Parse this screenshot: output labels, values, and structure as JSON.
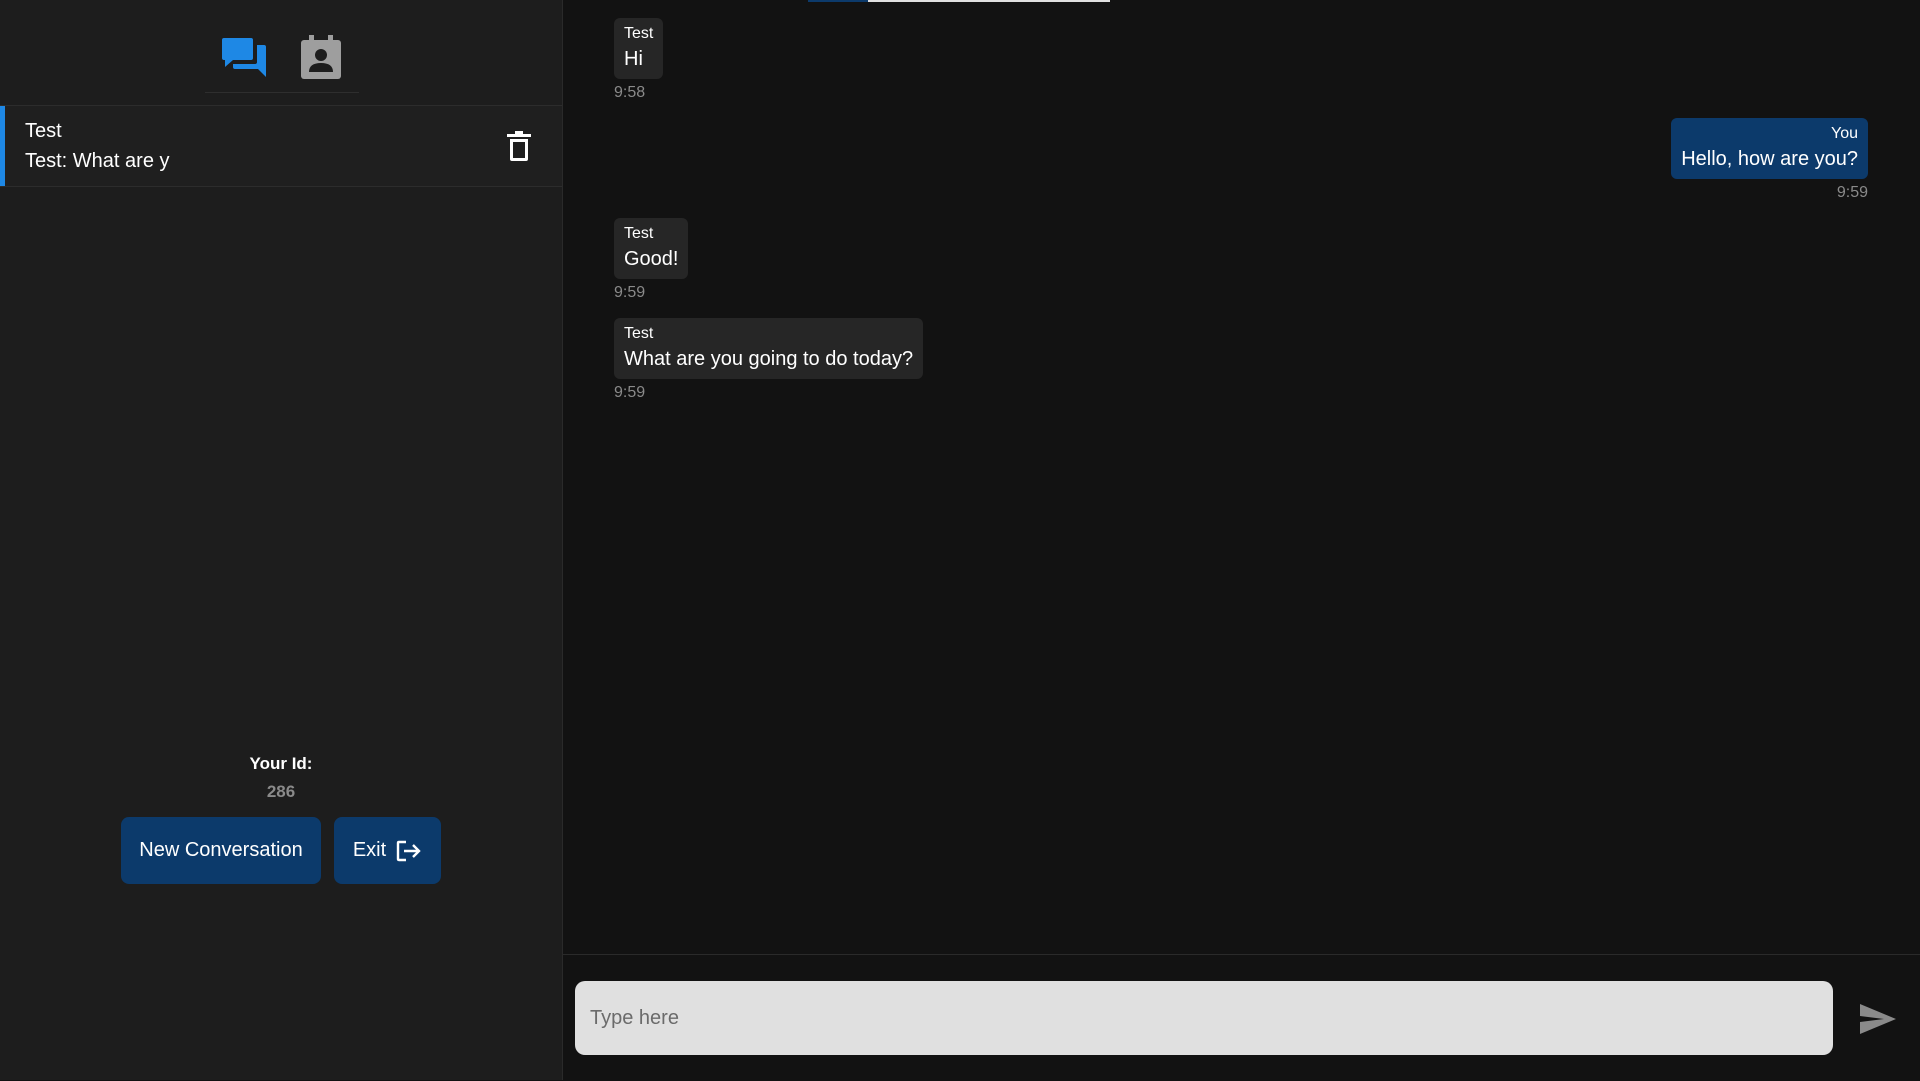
{
  "sidebar": {
    "tabs": [
      {
        "icon": "chat-icon",
        "color": "#1e88e5"
      },
      {
        "icon": "contacts-icon",
        "color": "#9e9e9e"
      }
    ],
    "conversations": [
      {
        "name": "Test",
        "preview": "Test: What are y"
      }
    ],
    "id_label": "Your Id:",
    "id_value": "286",
    "new_button": "New Conversation",
    "exit_button": "Exit"
  },
  "messages": [
    {
      "sender": "Test",
      "text": "Hi",
      "time": "9:58",
      "mine": false
    },
    {
      "sender": "You",
      "text": "Hello, how are you?",
      "time": "9:59",
      "mine": true
    },
    {
      "sender": "Test",
      "text": "Good!",
      "time": "9:59",
      "mine": false
    },
    {
      "sender": "Test",
      "text": "What are you going to do today?",
      "time": "9:59",
      "mine": false
    }
  ],
  "composer": {
    "placeholder": "Type here",
    "value": ""
  },
  "colors": {
    "accent": "#1e88e5",
    "button": "#0c3a6b",
    "sidebar_bg": "#1d1d1d",
    "main_bg": "#121212"
  }
}
